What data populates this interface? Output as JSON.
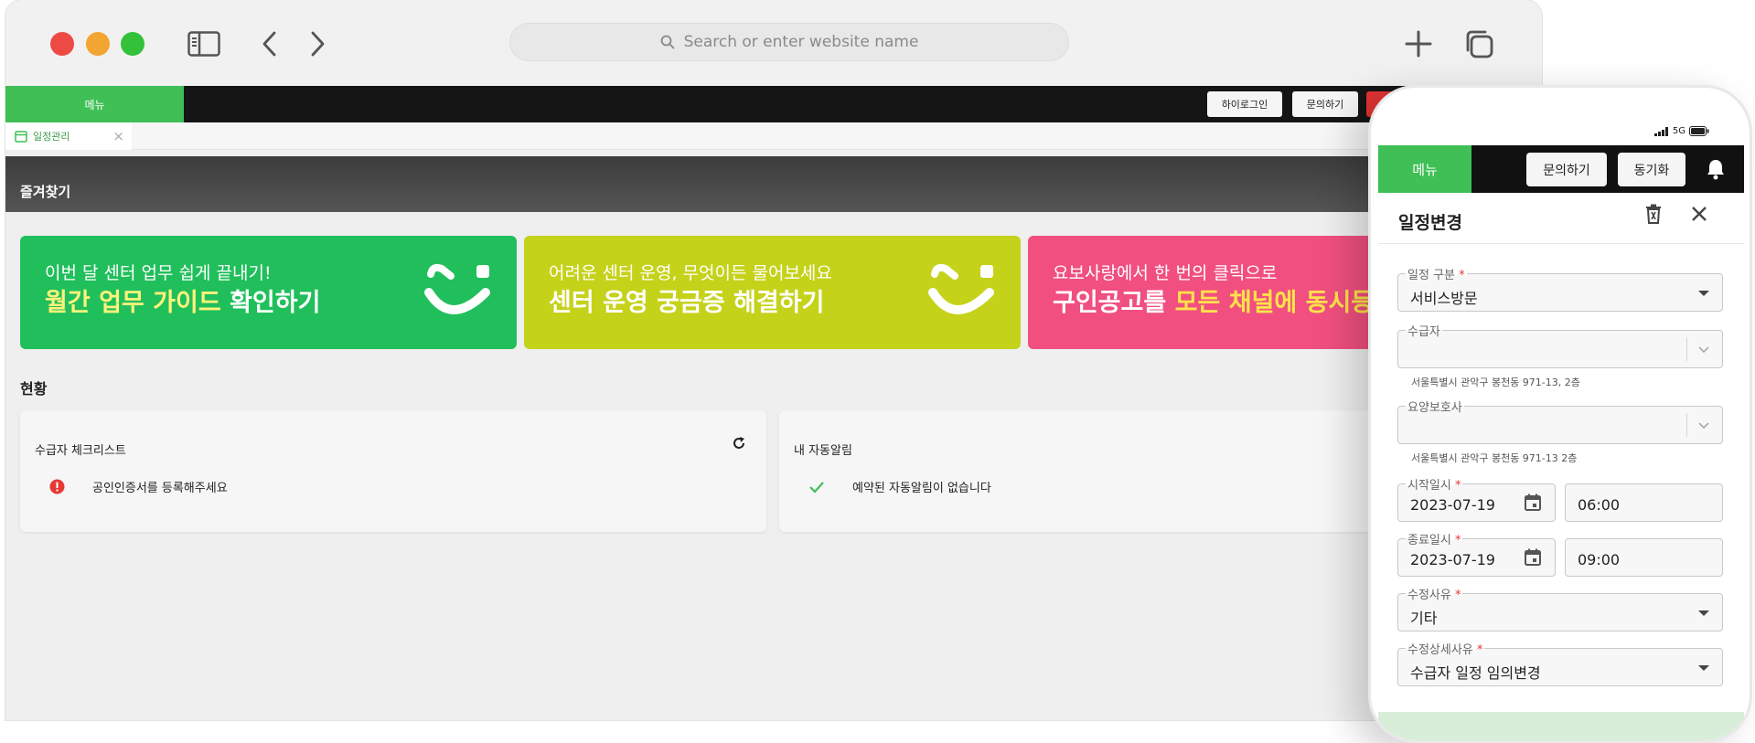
{
  "browser": {
    "address_placeholder": "Search or enter website name"
  },
  "topnav": {
    "menu_label": "메뉴",
    "buttons": [
      "하이로그인",
      "문의하기"
    ]
  },
  "tab": {
    "label": "일정관리",
    "close": "×"
  },
  "favorites": {
    "title": "즐겨찾기"
  },
  "banners": [
    {
      "sub": "이번 달 센터 업무 쉽게 끝내기!",
      "highlight": "월간 업무 가이드",
      "rest": " 확인하기",
      "color": "#20bf5b"
    },
    {
      "sub": "어려운 센터 운영, 무엇이든 물어보세요",
      "highlight": "",
      "rest": "센터 운영 궁금증 해결하기",
      "color": "#c5d21a"
    },
    {
      "sub": "요보사랑에서 한 번의 클릭으로",
      "prefix": "구인공고를 ",
      "highlight": "모든 채널에 동시등록",
      "color": "#f04f7f"
    }
  ],
  "status_section": {
    "title": "현황",
    "cards": [
      {
        "title": "수급자 체크리스트",
        "row_text": "공인인증서를 등록해주세요"
      },
      {
        "title": "내 자동알림",
        "row_text": "예약된 자동알림이 없습니다"
      }
    ]
  },
  "phone": {
    "status_network": "5G",
    "nav": {
      "menu_label": "메뉴",
      "buttons": [
        "문의하기",
        "동기화"
      ]
    },
    "sheet_title": "일정변경",
    "fields": {
      "type": {
        "label": "일정 구분",
        "value": "서비스방문"
      },
      "recipient": {
        "label": "수급자",
        "value": "",
        "hint": "서울특별시 관악구 봉천동 971-13, 2층"
      },
      "caregiver": {
        "label": "요양보호사",
        "value": "",
        "hint": "서울특별시 관악구 봉천동 971-13 2층"
      },
      "start": {
        "label": "시작일시",
        "date": "2023-07-19",
        "time": "06:00"
      },
      "end": {
        "label": "종료일시",
        "date": "2023-07-19",
        "time": "09:00"
      },
      "reason": {
        "label": "수정사유",
        "value": "기타"
      },
      "reason_detail": {
        "label": "수정상세사유",
        "value": "수급자 일정 임의변경"
      }
    },
    "required_mark": "*"
  }
}
